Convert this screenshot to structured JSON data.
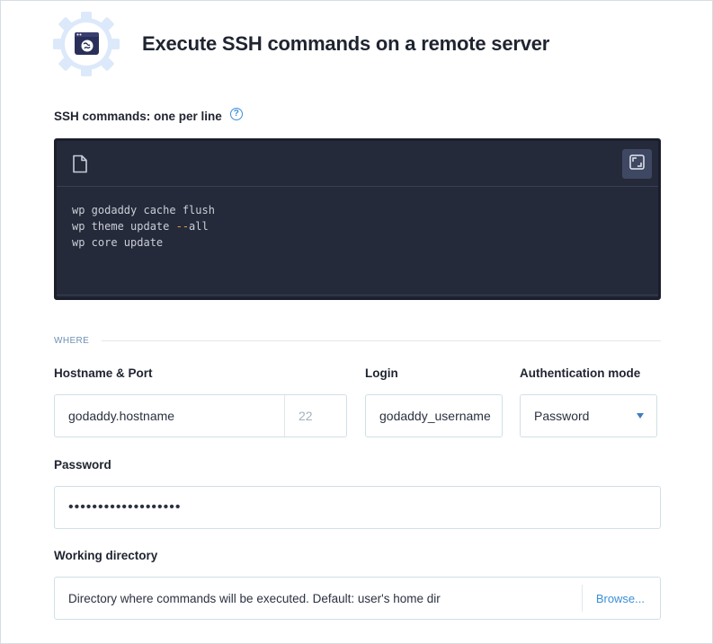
{
  "header": {
    "title": "Execute SSH commands on a remote server",
    "icon": "globe-window-gear-icon"
  },
  "commands": {
    "label": "SSH commands: one per line",
    "help_icon": "?",
    "file_icon": "file-icon",
    "expand_icon": "expand-icon",
    "lines": [
      {
        "pre": "wp godaddy cache flush",
        "flag": "",
        "post": ""
      },
      {
        "pre": "wp theme update ",
        "flag": "--",
        "post": "all"
      },
      {
        "pre": "wp core update",
        "flag": "",
        "post": ""
      }
    ]
  },
  "where": {
    "section_label": "WHERE",
    "hostname_label": "Hostname & Port",
    "hostname_value": "godaddy.hostname",
    "port_value": "22",
    "login_label": "Login",
    "login_value": "godaddy_username",
    "auth_label": "Authentication mode",
    "auth_value": "Password",
    "password_label": "Password",
    "password_value": "•••••••••••••••••••",
    "workdir_label": "Working directory",
    "workdir_placeholder": "Directory where commands will be executed. Default: user's home dir",
    "browse_label": "Browse..."
  },
  "colors": {
    "editor_bg": "#252a3a",
    "accent": "#3b8fd8",
    "badge_gear": "#dbe9fa",
    "badge_inner": "#2a2f5a"
  }
}
